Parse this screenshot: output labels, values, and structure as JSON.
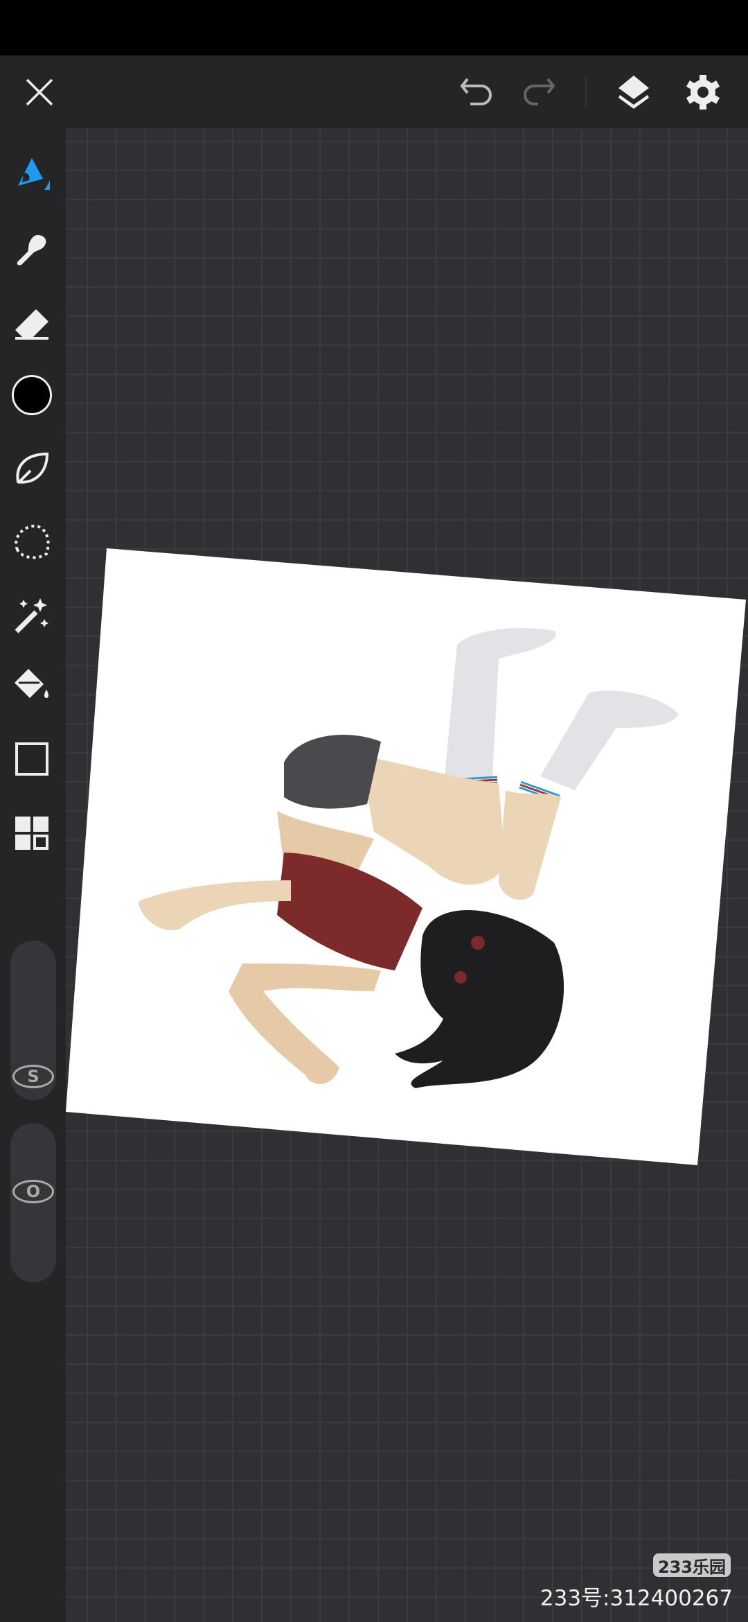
{
  "toolbar": {
    "close": "close",
    "undo": "undo",
    "redo": "redo",
    "layers": "layers",
    "settings": "settings"
  },
  "sidebar": {
    "tools": [
      "brush",
      "smudge",
      "eraser",
      "color",
      "lasso",
      "selection",
      "magic-wand",
      "fill",
      "shape",
      "layout"
    ],
    "current_color": "#000000",
    "accent": "#1e9bf0"
  },
  "sliders": {
    "size_label": "S",
    "opacity_label": "O"
  },
  "watermark": {
    "badge": "233乐园",
    "id_text": "233号:312400267"
  }
}
